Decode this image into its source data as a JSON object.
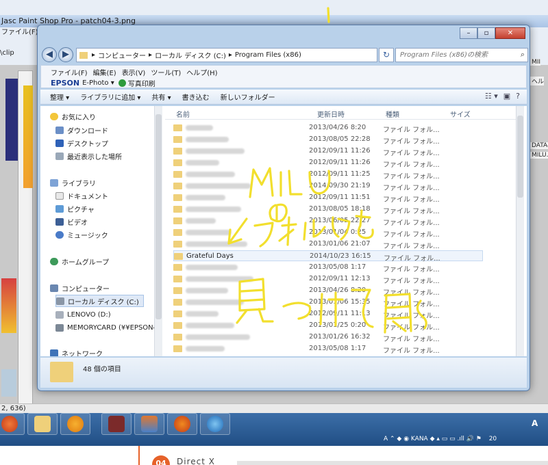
{
  "psp": {
    "title": "Jasc Paint Shop Pro - patch04-3.png",
    "menu": "ファイル(F)",
    "path": "\\clip",
    "status": "2, 636)",
    "right_items": [
      "MII",
      "ヘル",
      "DATA-",
      "MILU."
    ]
  },
  "explorer": {
    "window_buttons": {
      "minimize": "–",
      "maximize": "▫",
      "close": "✕"
    },
    "nav": {
      "back": "◀",
      "forward": "▶"
    },
    "breadcrumb": [
      "コンピューター",
      "ローカル ディスク (C:)",
      "Program Files (x86)"
    ],
    "breadcrumb_sep": "▸",
    "refresh": "↻",
    "search": {
      "placeholder": "Program Files (x86)の検索",
      "icon": "search-icon"
    },
    "menu": [
      "ファイル(F)",
      "編集(E)",
      "表示(V)",
      "ツール(T)",
      "ヘルプ(H)"
    ],
    "epson": {
      "brand": "EPSON",
      "app": "E-Photo ▾",
      "photo_print": "写真印刷"
    },
    "toolbar": [
      "整理 ▾",
      "ライブラリに追加 ▾",
      "共有 ▾",
      "書き込む",
      "新しいフォルダー"
    ],
    "toolbar_icons": [
      "view-icon",
      "preview-pane-icon",
      "help-icon"
    ],
    "nav_pane": {
      "favorites": {
        "label": "お気に入り",
        "items": [
          "ダウンロード",
          "デスクトップ",
          "最近表示した場所"
        ]
      },
      "libraries": {
        "label": "ライブラリ",
        "items": [
          "ドキュメント",
          "ピクチャ",
          "ビデオ",
          "ミュージック"
        ]
      },
      "homegroup": "ホームグループ",
      "computer": {
        "label": "コンピューター",
        "items": [
          "ローカル ディスク (C:)",
          "LENOVO (D:)",
          "MEMORYCARD (¥¥EPSON4"
        ]
      },
      "network": "ネットワーク"
    },
    "columns": {
      "name": "名前",
      "date": "更新日時",
      "type": "種類",
      "size": "サイズ"
    },
    "files": [
      {
        "name": "",
        "date": "2013/04/26 8:20",
        "type": "ファイル フォル..."
      },
      {
        "name": "",
        "date": "2013/08/05 22:28",
        "type": "ファイル フォル..."
      },
      {
        "name": "",
        "date": "2012/09/11 11:26",
        "type": "ファイル フォル..."
      },
      {
        "name": "",
        "date": "2012/09/11 11:26",
        "type": "ファイル フォル..."
      },
      {
        "name": "",
        "date": "2012/09/11 11:25",
        "type": "ファイル フォル..."
      },
      {
        "name": "",
        "date": "2014/09/30 21:19",
        "type": "ファイル フォル..."
      },
      {
        "name": "",
        "date": "2012/09/11 11:51",
        "type": "ファイル フォル..."
      },
      {
        "name": "",
        "date": "2013/08/05 18:18",
        "type": "ファイル フォル..."
      },
      {
        "name": "",
        "date": "2013/06/05 22:27",
        "type": "ファイル フォル..."
      },
      {
        "name": "",
        "date": "2013/01/04 0:25",
        "type": "ファイル フォル..."
      },
      {
        "name": "",
        "date": "2013/01/06 21:07",
        "type": "ファイル フォル..."
      },
      {
        "name": "Grateful Days",
        "date": "2014/10/23 16:15",
        "type": "ファイル フォル..."
      },
      {
        "name": "",
        "date": "2013/05/08 1:17",
        "type": "ファイル フォル..."
      },
      {
        "name": "",
        "date": "2012/09/11 12:13",
        "type": "ファイル フォル..."
      },
      {
        "name": "",
        "date": "2013/04/26 8:20",
        "type": "ファイル フォル..."
      },
      {
        "name": "",
        "date": "2013/01/06 15:35",
        "type": "ファイル フォル..."
      },
      {
        "name": "",
        "date": "2012/09/11 11:13",
        "type": "ファイル フォル..."
      },
      {
        "name": "",
        "date": "2013/01/25 0:20",
        "type": "ファイル フォル..."
      },
      {
        "name": "",
        "date": "2013/01/26 16:32",
        "type": "ファイル フォル..."
      },
      {
        "name": "",
        "date": "2013/05/08 1:17",
        "type": "ファイル フォル..."
      }
    ],
    "item_count": "48 個の項目"
  },
  "taskbar": {
    "tray_text": "A ⌃ ◆ ◉ KANA ◆ ▴ ▭ ▭ .ıll 🔊 ⚑",
    "lang": "A",
    "year_fragment": "20"
  },
  "page_fragment": {
    "badge": "04",
    "text": "Direct X"
  },
  "colors": {
    "accent": "#3c6ea8",
    "handwriting": "#f2df2e",
    "folder": "#efd07a"
  }
}
